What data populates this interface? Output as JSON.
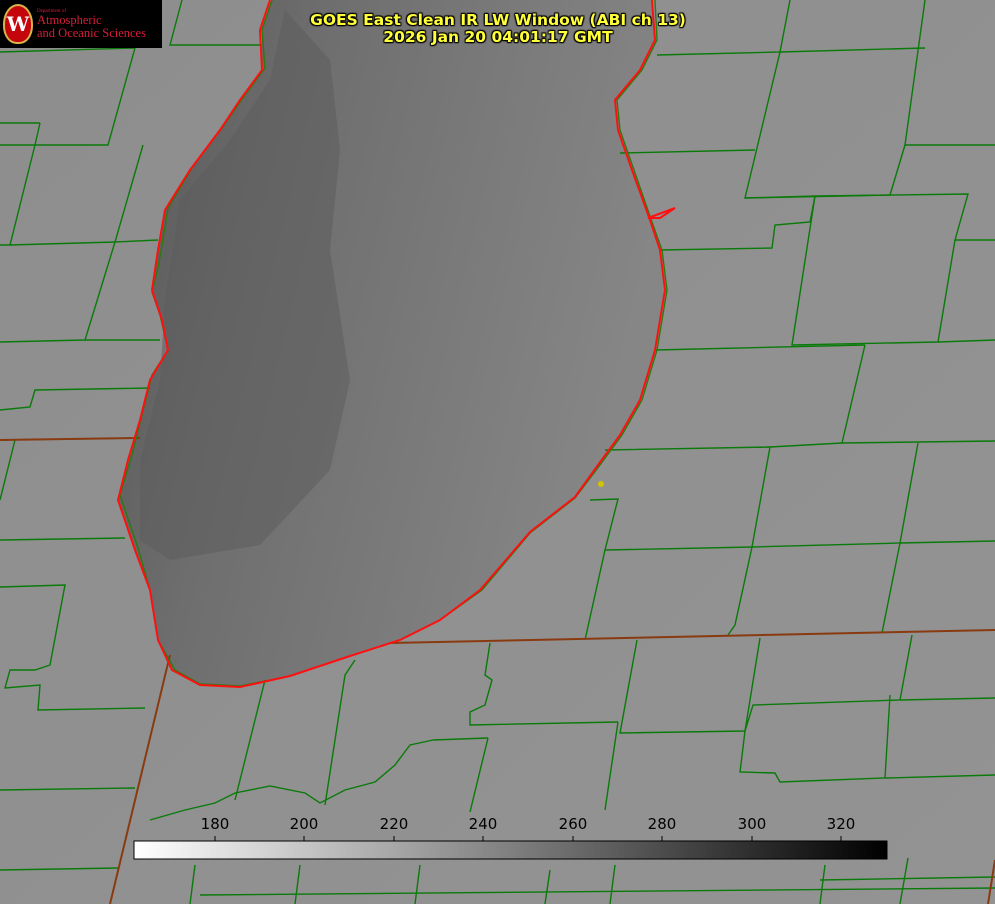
{
  "logo": {
    "dept": "Department of",
    "line1": "Atmospheric",
    "line2": "and Oceanic Sciences",
    "mark": "W"
  },
  "title": {
    "line1": "GOES East Clean IR LW Window (ABI ch 13)",
    "line2": "2026 Jan 20 04:01:17 GMT"
  },
  "colorbar": {
    "ticks": [
      "180",
      "200",
      "220",
      "240",
      "260",
      "280",
      "300",
      "320"
    ],
    "range": [
      162,
      330
    ],
    "colormap": "white-to-black"
  },
  "colors": {
    "land": "#8d8d8d",
    "lake": "#6d6d6d",
    "county_border": "#0a7a0a",
    "state_border": "#8a3a10",
    "shoreline": "#ff1010",
    "title": "#ffff3a",
    "marker": "#d4c400"
  },
  "icons": [
    "university-seal-icon",
    "location-marker-icon"
  ]
}
